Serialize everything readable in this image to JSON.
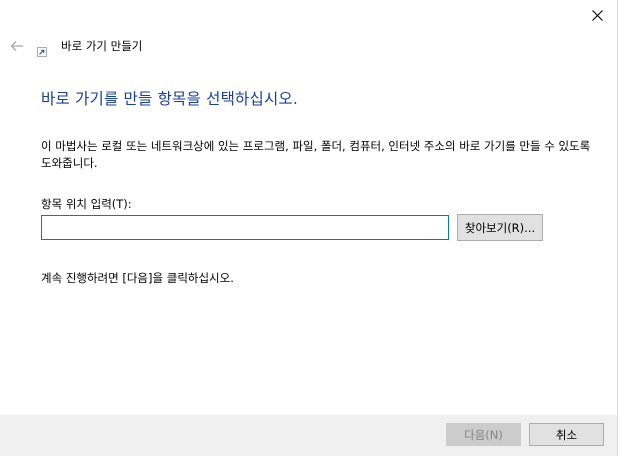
{
  "window": {
    "title": "바로 가기 만들기",
    "close_icon": "close-icon",
    "back_icon": "back-arrow-icon",
    "wizard_icon": "shortcut-icon"
  },
  "main": {
    "heading": "바로 가기를 만들 항목을 선택하십시오.",
    "description": "이 마법사는 로컬 또는 네트워크상에 있는 프로그램, 파일, 폴더, 컴퓨터, 인터넷 주소의 바로 가기를 만들 수 있도록 도와줍니다.",
    "field_label": "항목 위치 입력(T):",
    "location_value": "",
    "browse_label": "찾아보기(R)...",
    "continue_text": "계속 진행하려면 [다음]을 클릭하십시오."
  },
  "footer": {
    "next_label": "다음(N)",
    "cancel_label": "취소"
  },
  "colors": {
    "heading": "#1a3f9a",
    "input_border": "#0078d7",
    "footer_bg": "#f0f0f0",
    "button_bg": "#e1e1e1",
    "disabled_text": "#838383"
  }
}
